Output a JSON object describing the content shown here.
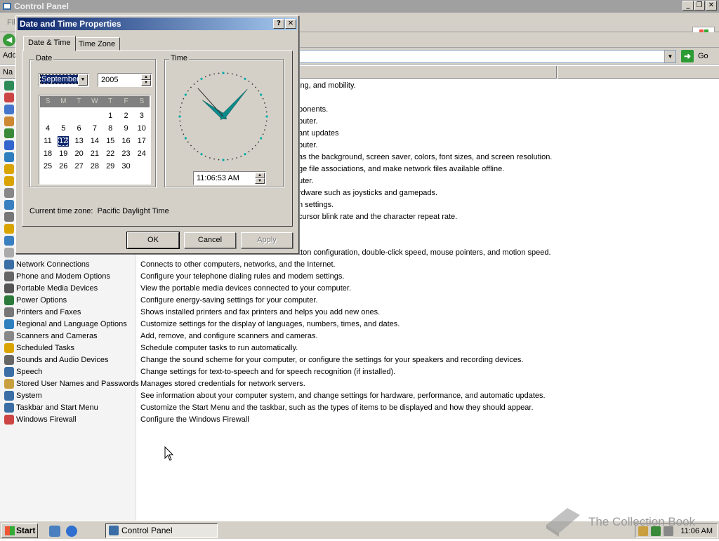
{
  "main_window": {
    "title": "Control Panel",
    "file_menu": "Fil",
    "address_label": "Add",
    "go_label": "Go",
    "header_name": "Na"
  },
  "rows": [
    {
      "name": "",
      "desc": "ing, and mobility.",
      "color": "#2e8b57"
    },
    {
      "name": "",
      "desc": "",
      "color": "#c44"
    },
    {
      "name": "",
      "desc": "ponents.",
      "color": "#4477cc"
    },
    {
      "name": "",
      "desc": "puter.",
      "color": "#cc8833"
    },
    {
      "name": "",
      "desc": "ant updates",
      "color": "#3a8a3a"
    },
    {
      "name": "",
      "desc": "puter.",
      "color": "#3366cc"
    },
    {
      "name": "",
      "desc": "as the background, screen saver, colors, font sizes, and screen resolution.",
      "color": "#2f7fbf"
    },
    {
      "name": "",
      "desc": "ge file associations, and make network files available offline.",
      "color": "#d9a400"
    },
    {
      "name": "",
      "desc": "uter.",
      "color": "#d9a400"
    },
    {
      "name": "",
      "desc": "rdware such as joysticks and gamepads.",
      "color": "#888"
    },
    {
      "name": "",
      "desc": "n settings.",
      "color": "#3a7fbf"
    },
    {
      "name": "",
      "desc": "cursor blink rate and the character repeat rate.",
      "color": "#777"
    },
    {
      "name": "",
      "desc": "",
      "color": "#d9a400"
    },
    {
      "name": "",
      "desc": "",
      "color": "#3a7fbf"
    },
    {
      "name": "",
      "desc": "tton configuration, double-click speed, mouse pointers, and motion speed.",
      "color": "#aaa"
    },
    {
      "name": "Network Connections",
      "desc": "Connects to other computers, networks, and the Internet.",
      "color": "#3a6ea5"
    },
    {
      "name": "Phone and Modem Options",
      "desc": "Configure your telephone dialing rules and modem settings.",
      "color": "#666"
    },
    {
      "name": "Portable Media Devices",
      "desc": "View the portable media devices connected to your computer.",
      "color": "#555"
    },
    {
      "name": "Power Options",
      "desc": "Configure energy-saving settings for your computer.",
      "color": "#2c7a3a"
    },
    {
      "name": "Printers and Faxes",
      "desc": "Shows installed printers and fax printers and helps you add new ones.",
      "color": "#777"
    },
    {
      "name": "Regional and Language Options",
      "desc": "Customize settings for the display of languages, numbers, times, and dates.",
      "color": "#2f7fbf"
    },
    {
      "name": "Scanners and Cameras",
      "desc": "Add, remove, and configure scanners and cameras.",
      "color": "#888"
    },
    {
      "name": "Scheduled Tasks",
      "desc": "Schedule computer tasks to run automatically.",
      "color": "#d9a400"
    },
    {
      "name": "Sounds and Audio Devices",
      "desc": "Change the sound scheme for your computer, or configure the settings for your speakers and recording devices.",
      "color": "#666"
    },
    {
      "name": "Speech",
      "desc": "Change settings for text-to-speech and for speech recognition (if installed).",
      "color": "#3a6ea5"
    },
    {
      "name": "Stored User Names and Passwords",
      "desc": "Manages stored credentials for network servers.",
      "color": "#c8a040"
    },
    {
      "name": "System",
      "desc": "See information about your computer system, and change settings for hardware, performance, and automatic updates.",
      "color": "#3a6ea5"
    },
    {
      "name": "Taskbar and Start Menu",
      "desc": "Customize the Start Menu and the taskbar, such as the types of items to be displayed and how they should appear.",
      "color": "#3a6ea5"
    },
    {
      "name": "Windows Firewall",
      "desc": "Configure the Windows Firewall",
      "color": "#c44"
    }
  ],
  "dialog": {
    "title": "Date and Time Properties",
    "help_btn": "?",
    "close_btn": "✕",
    "tabs": [
      {
        "label": "Date & Time"
      },
      {
        "label": "Time Zone"
      }
    ],
    "date_group": "Date",
    "time_group": "Time",
    "month_value": "September",
    "year_value": "2005",
    "weekdays": [
      "S",
      "M",
      "T",
      "W",
      "T",
      "F",
      "S"
    ],
    "selected_day": 12,
    "time_value": "11:06:53 AM",
    "clock": {
      "hour": 11,
      "minute": 6,
      "second": 53
    },
    "current_tz_label": "Current time zone:",
    "current_tz_value": "Pacific Daylight Time",
    "ok": "OK",
    "cancel": "Cancel",
    "apply": "Apply"
  },
  "taskbar": {
    "start": "Start",
    "task_label": "Control Panel",
    "clock": "11:06 AM"
  },
  "watermark": "The Collection Book"
}
